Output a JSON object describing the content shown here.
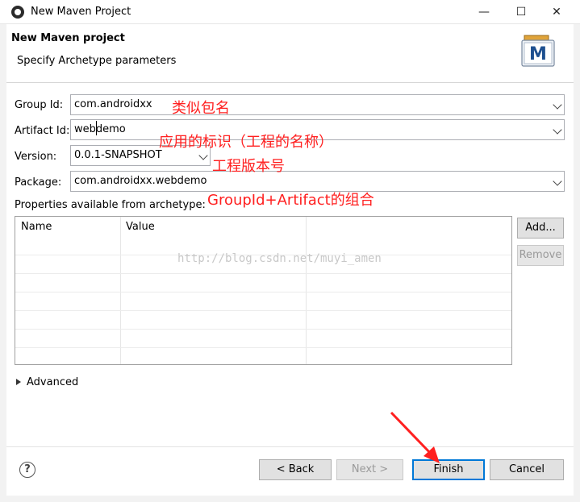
{
  "window": {
    "title": "New Maven Project",
    "minimize_glyph": "—",
    "maximize_glyph": "☐",
    "close_glyph": "✕"
  },
  "header": {
    "title": "New Maven project",
    "subtitle": "Specify Archetype parameters",
    "icon_letter": "M"
  },
  "form": {
    "group_id_label": "Group Id:",
    "group_id_value": "com.androidxx",
    "artifact_id_label": "Artifact Id:",
    "artifact_id_value": "webdemo",
    "version_label": "Version:",
    "version_value": "0.0.1-SNAPSHOT",
    "package_label": "Package:",
    "package_value": "com.androidxx.webdemo",
    "properties_label": "Properties available from archetype:"
  },
  "table": {
    "columns": [
      "Name",
      "Value"
    ]
  },
  "buttons": {
    "add": "Add...",
    "remove": "Remove",
    "back": "< Back",
    "next": "Next >",
    "finish": "Finish",
    "cancel": "Cancel",
    "help": "?"
  },
  "advanced_label": "Advanced",
  "annotations": {
    "group_id": "类似包名",
    "artifact_id": "应用的标识（工程的名称）",
    "version": "工程版本号",
    "package": "GroupId+Artifact的组合"
  },
  "watermark": "http://blog.csdn.net/muyi_amen",
  "colors": {
    "annotation": "#ff2020",
    "accent": "#0078d7"
  }
}
